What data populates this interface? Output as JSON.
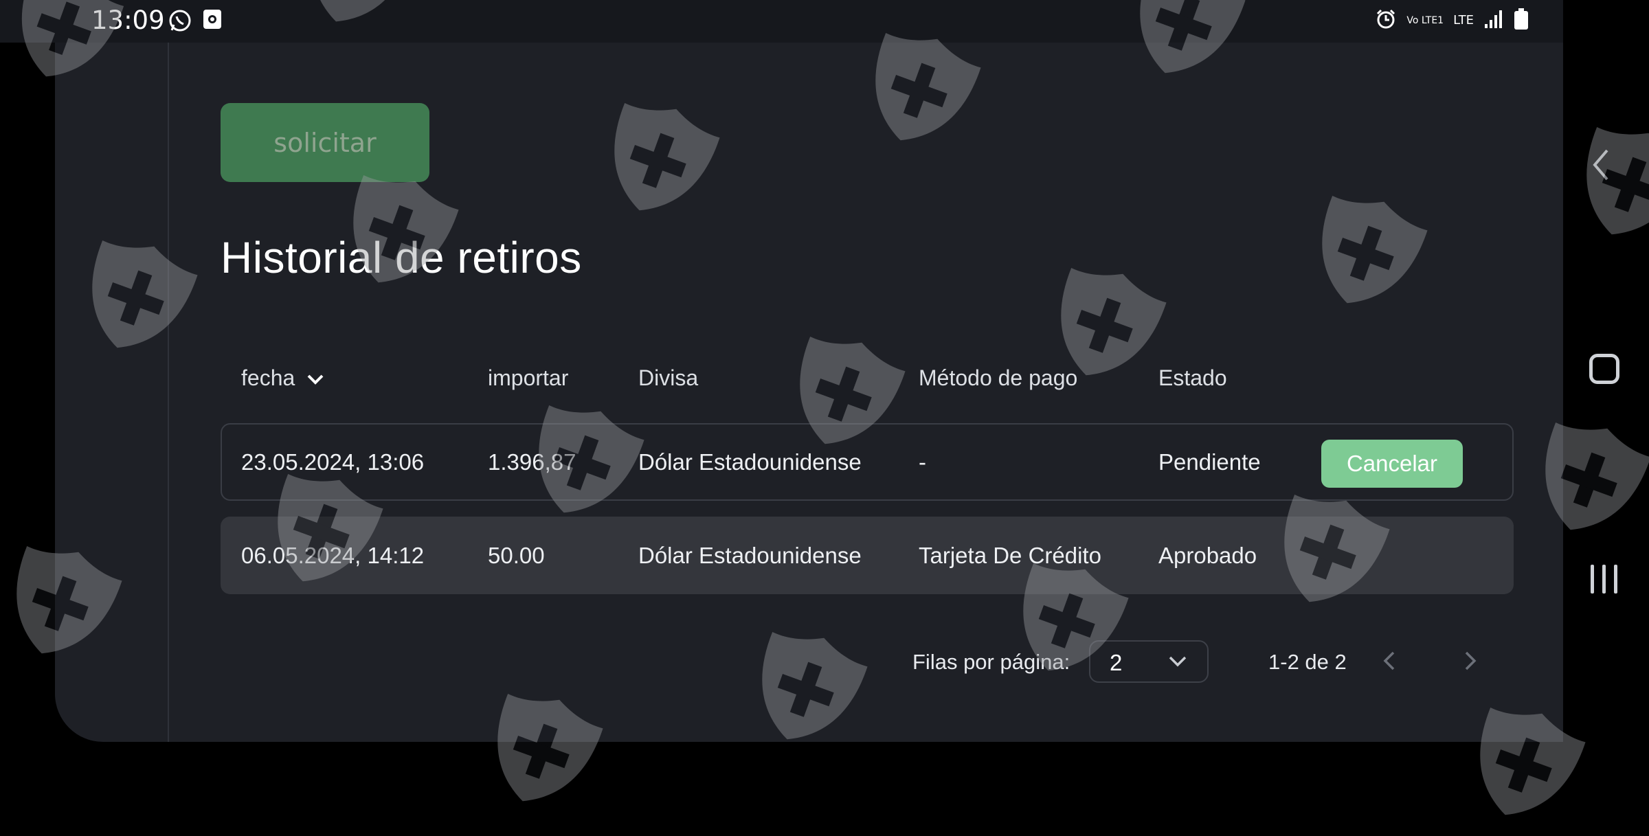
{
  "status_bar": {
    "time": "13:09",
    "icons_left": [
      "whatsapp-icon",
      "screen-record-icon"
    ],
    "icons_right": [
      "alarm-icon",
      "volte-icon",
      "lte-icon",
      "signal-icon",
      "battery-icon"
    ],
    "volte_text": "Vo LTE1",
    "lte_text": "LTE"
  },
  "main": {
    "request_button_label": "solicitar",
    "title": "Historial de retiros"
  },
  "table": {
    "headers": {
      "date": "fecha",
      "amount": "importar",
      "currency": "Divisa",
      "method": "Método de pago",
      "status": "Estado"
    },
    "rows": [
      {
        "date": "23.05.2024, 13:06",
        "amount": "1.396,87",
        "currency": "Dólar Estadounidense",
        "method": "-",
        "status": "Pendiente",
        "action": "Cancelar"
      },
      {
        "date": "06.05.2024, 14:12",
        "amount": "50.00",
        "currency": "Dólar Estadounidense",
        "method": "Tarjeta De Crédito",
        "status": "Aprobado"
      }
    ]
  },
  "pagination": {
    "rows_per_page_label": "Filas por página:",
    "rows_per_page_value": "2",
    "range": "1-2 de 2"
  },
  "colors": {
    "background": "#1e2026",
    "request_button": "#3f7a50",
    "cancel_button": "#7ecb94",
    "row_highlight": "#34363c"
  }
}
